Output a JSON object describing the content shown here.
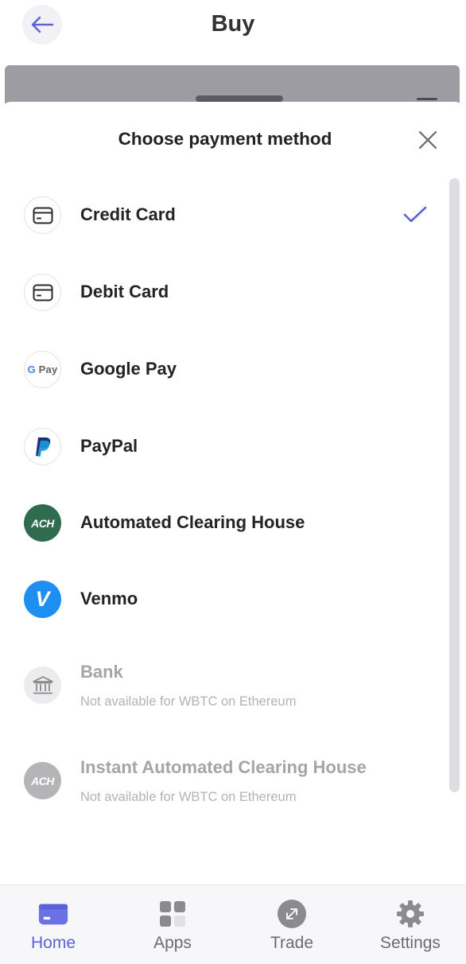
{
  "header": {
    "title": "Buy",
    "back_icon": "arrow-left-icon"
  },
  "sheet": {
    "title": "Choose payment method",
    "close_icon": "close-icon",
    "methods": [
      {
        "label": "Credit Card",
        "icon": "credit-card-icon",
        "selected": true,
        "available": true
      },
      {
        "label": "Debit Card",
        "icon": "debit-card-icon",
        "selected": false,
        "available": true
      },
      {
        "label": "Google Pay",
        "icon": "google-pay-logo",
        "icon_text": "G Pay",
        "selected": false,
        "available": true
      },
      {
        "label": "PayPal",
        "icon": "paypal-logo",
        "icon_text": "P",
        "selected": false,
        "available": true
      },
      {
        "label": "Automated Clearing House",
        "icon": "ach-logo",
        "icon_text": "ACH",
        "selected": false,
        "available": true
      },
      {
        "label": "Venmo",
        "icon": "venmo-logo",
        "icon_text": "V",
        "selected": false,
        "available": true
      },
      {
        "label": "Bank",
        "icon": "bank-icon",
        "sub": "Not available for WBTC on Ethereum",
        "selected": false,
        "available": false
      },
      {
        "label": "Instant Automated Clearing House",
        "icon": "ach-logo",
        "icon_text": "ACH",
        "sub": "Not available for WBTC on Ethereum",
        "selected": false,
        "available": false
      }
    ]
  },
  "nav": {
    "items": [
      {
        "label": "Home",
        "icon": "home-card-icon",
        "active": true
      },
      {
        "label": "Apps",
        "icon": "apps-grid-icon",
        "active": false
      },
      {
        "label": "Trade",
        "icon": "trade-arrows-icon",
        "active": false
      },
      {
        "label": "Settings",
        "icon": "gear-icon",
        "active": false
      }
    ]
  },
  "colors": {
    "accent": "#5b63d6",
    "ach_green": "#2f6b4f",
    "venmo_blue": "#1f8ef1",
    "paypal_dark": "#1f2e7a",
    "paypal_light": "#1e9bd7",
    "disabled_text": "#a5a5a5"
  }
}
